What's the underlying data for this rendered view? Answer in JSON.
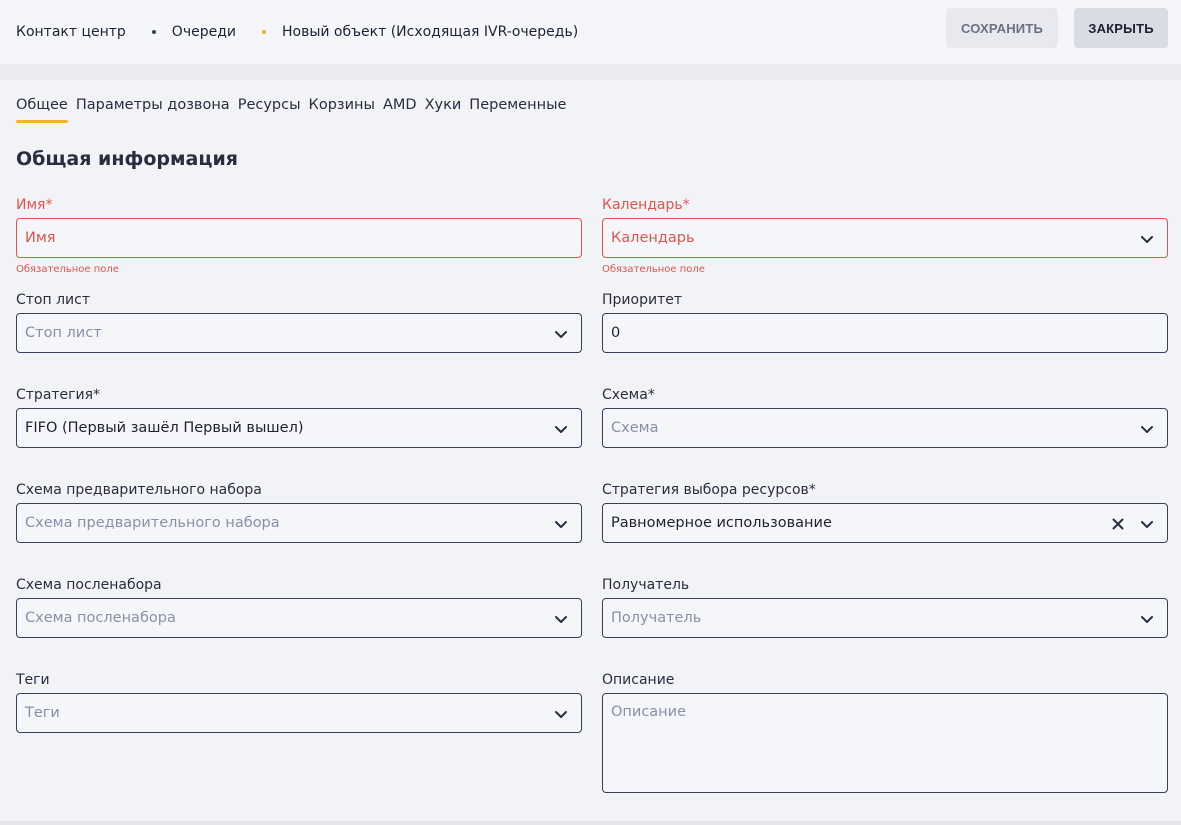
{
  "breadcrumb": {
    "items": [
      "Контакт центр",
      "Очереди",
      "Новый объект (Исходящая IVR-очередь)"
    ]
  },
  "toolbar": {
    "save_label": "СОХРАНИТЬ",
    "close_label": "ЗАКРЫТЬ"
  },
  "tabs": [
    {
      "label": "Общее",
      "active": true
    },
    {
      "label": "Параметры дозвона"
    },
    {
      "label": "Ресурсы"
    },
    {
      "label": "Корзины"
    },
    {
      "label": "AMD"
    },
    {
      "label": "Хуки"
    },
    {
      "label": "Переменные"
    }
  ],
  "section_title": "Общая информация",
  "fields": {
    "name": {
      "label": "Имя*",
      "placeholder": "Имя",
      "hint": "Обязательное поле"
    },
    "calendar": {
      "label": "Календарь*",
      "placeholder": "Календарь",
      "hint": "Обязательное поле"
    },
    "stop_list": {
      "label": "Стоп лист",
      "placeholder": "Стоп лист"
    },
    "priority": {
      "label": "Приоритет",
      "value": "0"
    },
    "strategy": {
      "label": "Стратегия*",
      "value": "FIFO (Первый зашёл Первый вышел)"
    },
    "scheme": {
      "label": "Схема*",
      "placeholder": "Схема"
    },
    "predial_scheme": {
      "label": "Схема предварительного набора",
      "placeholder": "Схема предварительного набора"
    },
    "resource_strategy": {
      "label": "Стратегия выбора ресурсов*",
      "value": "Равномерное использование"
    },
    "postdial_scheme": {
      "label": "Схема посленабора",
      "placeholder": "Схема посленабора"
    },
    "recipient": {
      "label": "Получатель",
      "placeholder": "Получатель"
    },
    "tags": {
      "label": "Теги",
      "placeholder": "Теги"
    },
    "description": {
      "label": "Описание",
      "placeholder": "Описание"
    }
  },
  "colors": {
    "accent": "#f5b22b",
    "error": "#e0544e",
    "border": "#3b3f5c"
  },
  "icons": {
    "dropdown": "chevron-down-icon",
    "clear": "close-icon"
  }
}
